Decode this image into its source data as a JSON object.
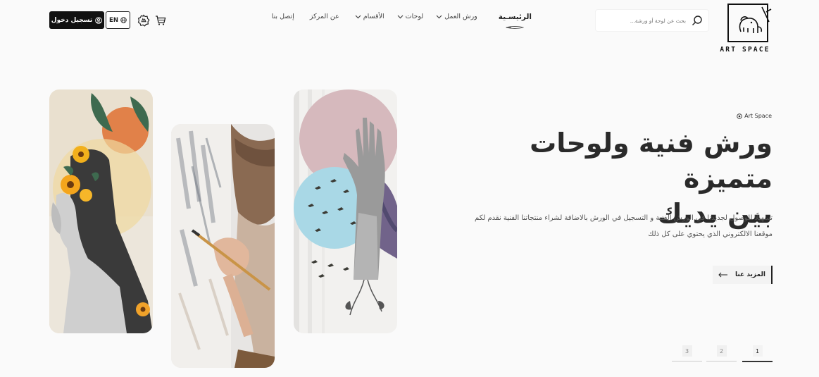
{
  "brand": {
    "logo_text": "ART SPACE"
  },
  "search": {
    "placeholder": "بحث عن لوحة أو ورشة..."
  },
  "nav": {
    "home": "الرئيسـية",
    "workshops": "ورش العمل",
    "paintings": "لوحات",
    "sections": "الأقسام",
    "about": "عن المركز",
    "contact": "إتصل بنا"
  },
  "header": {
    "login_label": "تسجيل دخول",
    "lang_label": "EN"
  },
  "hero": {
    "eyebrow": "Art Space",
    "title_line1": "ورش فنية ولوحات متميزة",
    "title_line2": "بين يديك",
    "desc_line1": "تسهيلًا للوصول لجديدنا في الورش الفنية و التسجيل في الورش بالاضافة لشراء منتجاتنا الفنية نقدم لكم",
    "desc_line2": "موقعنا الالكتروني الذي يحتوي على كل ذلك",
    "more_label": "المزيد عنا"
  },
  "pagination": {
    "pages": [
      "1",
      "2",
      "3"
    ],
    "active": "1"
  },
  "colors": {
    "primary": "#111111",
    "background": "#fafafa",
    "accent_orange": "#e0773a"
  },
  "icons": [
    "search-icon",
    "chevron-down-icon",
    "globe-icon",
    "user-icon",
    "badge-icon",
    "cart-icon",
    "arrow-left-icon",
    "logo-elephant-icon"
  ]
}
